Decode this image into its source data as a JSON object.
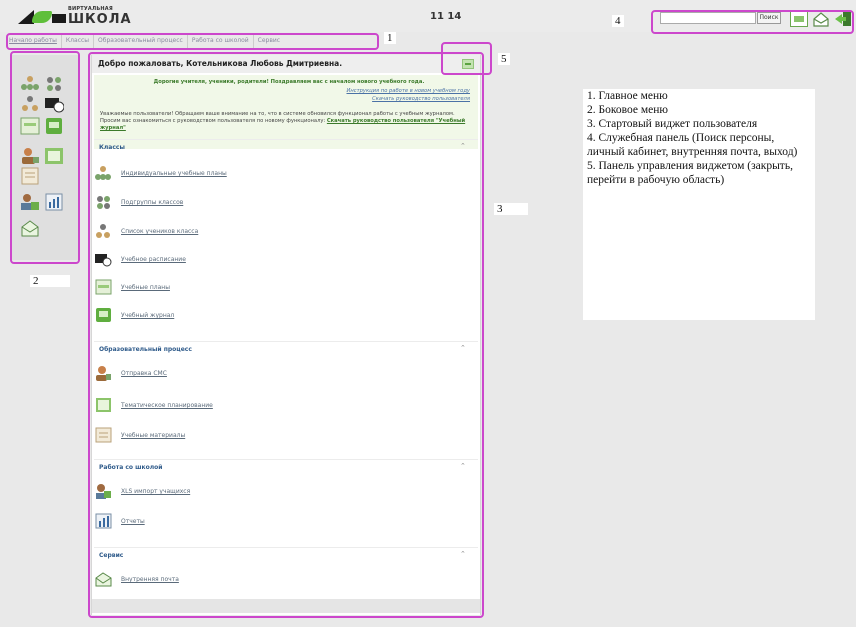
{
  "header": {
    "logo_small": "ВИРТУАЛЬНАЯ",
    "logo_big": "ШКОЛА",
    "clock": "11 14"
  },
  "service_panel": {
    "search_button": "Поиск",
    "icons": [
      "cabinet-icon",
      "mail-icon",
      "exit-icon"
    ]
  },
  "main_menu": [
    "Начало работы",
    "Классы",
    "Образовательный процесс",
    "Работа со школой",
    "Сервис"
  ],
  "widget": {
    "title": "Добро пожаловать, Котельникова Любовь Дмитриевна.",
    "greeting_title": "Дорогие учителя, ученики, родители! Поздравляем вас с началом нового учебного года.",
    "greeting_link1": "Инструкция по работе в новом учебном году",
    "greeting_link2": "Скачать руководство пользователя",
    "greeting_text": "Уважаемые пользователи! Обращаем ваше внимание на то, что в системе обновился функционал работы с учебным журналом. Просим вас ознакомиться с руководством пользователя по новому функционалу:",
    "greeting_text_link": "Скачать руководство пользователя \"Учебный журнал\"",
    "sections": [
      {
        "title": "Классы",
        "items": [
          "Индивидуальные учебные планы",
          "Подгруппы классов",
          "Список учеников класса",
          "Учебное расписание",
          "Учебные планы",
          "Учебный журнал"
        ]
      },
      {
        "title": "Образовательный процесс",
        "items": [
          "Отправка СМС",
          "Тематическое планирование",
          "Учебные материалы"
        ]
      },
      {
        "title": "Работа со школой",
        "items": [
          "XLS импорт учащихся",
          "Отчеты"
        ]
      },
      {
        "title": "Сервис",
        "items": [
          "Внутренняя почта"
        ]
      }
    ]
  },
  "annotations": {
    "labels": [
      "1",
      "2",
      "3",
      "4",
      "5"
    ],
    "legend": [
      "1. Главное меню",
      "2. Боковое меню",
      "3. Стартовый виджет пользователя",
      "4. Служебная панель (Поиск персоны, личный кабинет, внутренняя почта, выход)",
      "5. Панель управления виджетом (закрыть, перейти в рабочую область)"
    ],
    "color": "#cc47cc"
  }
}
